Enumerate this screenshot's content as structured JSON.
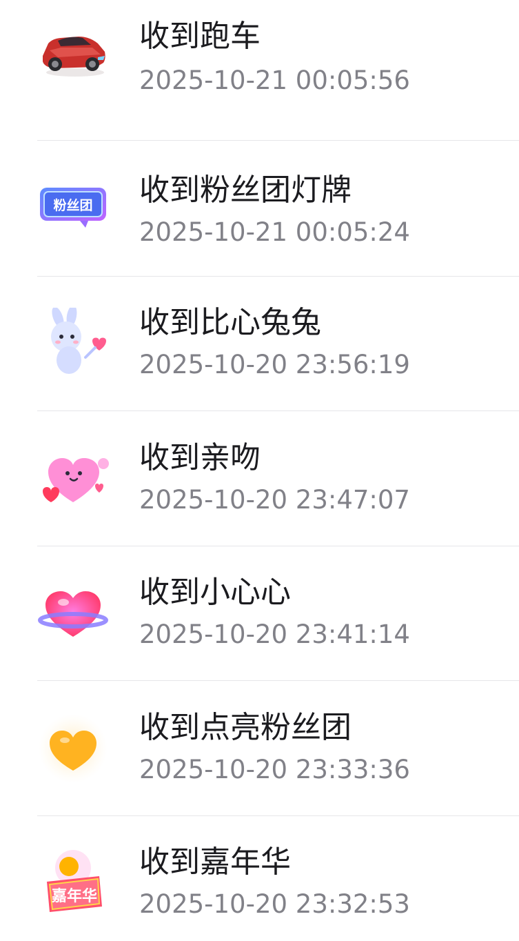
{
  "gift_records": [
    {
      "title": "收到跑车",
      "time": "2025-10-21 00:05:56",
      "icon": "sports-car-icon"
    },
    {
      "title": "收到粉丝团灯牌",
      "time": "2025-10-21 00:05:24",
      "icon": "fan-club-badge-icon",
      "icon_text": "粉丝团"
    },
    {
      "title": "收到比心兔兔",
      "time": "2025-10-20 23:56:19",
      "icon": "heart-bunny-icon"
    },
    {
      "title": "收到亲吻",
      "time": "2025-10-20 23:47:07",
      "icon": "kiss-heart-icon"
    },
    {
      "title": "收到小心心",
      "time": "2025-10-20 23:41:14",
      "icon": "little-heart-icon"
    },
    {
      "title": "收到点亮粉丝团",
      "time": "2025-10-20 23:33:36",
      "icon": "light-up-heart-icon"
    },
    {
      "title": "收到嘉年华",
      "time": "2025-10-20 23:32:53",
      "icon": "carnival-icon",
      "icon_text": "嘉年华"
    }
  ],
  "colors": {
    "title": "#1b1b1f",
    "time": "#818188",
    "divider": "#e6e6e9"
  }
}
